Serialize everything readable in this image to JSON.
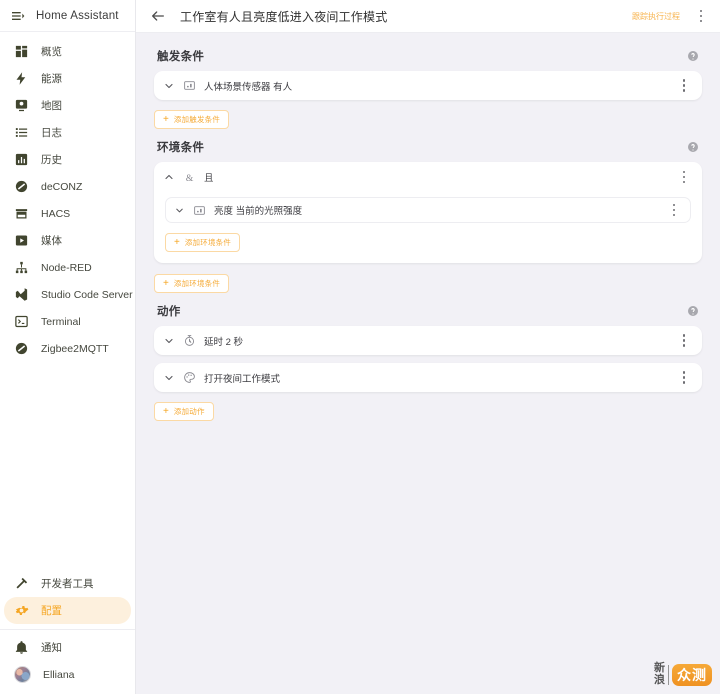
{
  "sidebar": {
    "brand": "Home Assistant",
    "menu_icon": "menu-collapse-icon",
    "items": [
      {
        "label": "概览",
        "icon": "view-dashboard-icon"
      },
      {
        "label": "能源",
        "icon": "lightning-bolt-icon"
      },
      {
        "label": "地图",
        "icon": "map-marker-icon"
      },
      {
        "label": "日志",
        "icon": "format-list-bulleted-icon"
      },
      {
        "label": "历史",
        "icon": "chart-box-icon"
      },
      {
        "label": "deCONZ",
        "icon": "circle-slash-icon"
      },
      {
        "label": "HACS",
        "icon": "store-icon"
      },
      {
        "label": "媒体",
        "icon": "play-box-icon"
      },
      {
        "label": "Node-RED",
        "icon": "sitemap-icon"
      },
      {
        "label": "Studio Code Server",
        "icon": "vscode-icon"
      },
      {
        "label": "Terminal",
        "icon": "console-icon"
      },
      {
        "label": "Zigbee2MQTT",
        "icon": "circle-slash-icon"
      }
    ],
    "bottom_items": [
      {
        "label": "开发者工具",
        "icon": "hammer-wrench-icon",
        "active": false
      },
      {
        "label": "配置",
        "icon": "cog-icon",
        "active": true
      }
    ],
    "footer_items": [
      {
        "label": "通知",
        "icon": "bell-icon"
      },
      {
        "label": "Elliana",
        "icon": "avatar"
      }
    ]
  },
  "topbar": {
    "back_icon": "arrow-left-icon",
    "title": "工作室有人且亮度低进入夜间工作模式",
    "trace_label": "跟踪执行过程",
    "overflow_icon": "dots-vertical-icon"
  },
  "sections": [
    {
      "id": "trigger",
      "title": "触发条件",
      "help_icon": "help-circle-icon",
      "cards": [
        {
          "label": "人体场景传感器 有人",
          "icon": "device-icon",
          "chevron": "chevron-down-icon"
        }
      ],
      "add_label": "添加触发条件"
    },
    {
      "id": "condition",
      "title": "环境条件",
      "help_icon": "help-circle-icon",
      "group": {
        "label": "且",
        "chevron": "chevron-up-icon",
        "icon": "ampersand-icon",
        "items": [
          {
            "label": "亮度 当前的光照强度",
            "icon": "device-icon",
            "chevron": "chevron-down-icon"
          }
        ],
        "add_label": "添加环境条件"
      },
      "add_label": "添加环境条件"
    },
    {
      "id": "action",
      "title": "动作",
      "help_icon": "help-circle-icon",
      "cards": [
        {
          "label": "延时 2 秒",
          "icon": "timer-icon",
          "chevron": "chevron-down-icon"
        },
        {
          "label": "打开夜间工作模式",
          "icon": "palette-icon",
          "chevron": "chevron-down-icon"
        }
      ],
      "add_label": "添加动作"
    }
  ],
  "watermark": {
    "line1": "新",
    "line2": "浪",
    "pill": "众测"
  },
  "colors": {
    "accent": "#f5a623",
    "accent_soft": "#fdf0dd",
    "page_bg": "#f2f1f6",
    "card_bg": "#ffffff",
    "text": "#3c3c41"
  }
}
